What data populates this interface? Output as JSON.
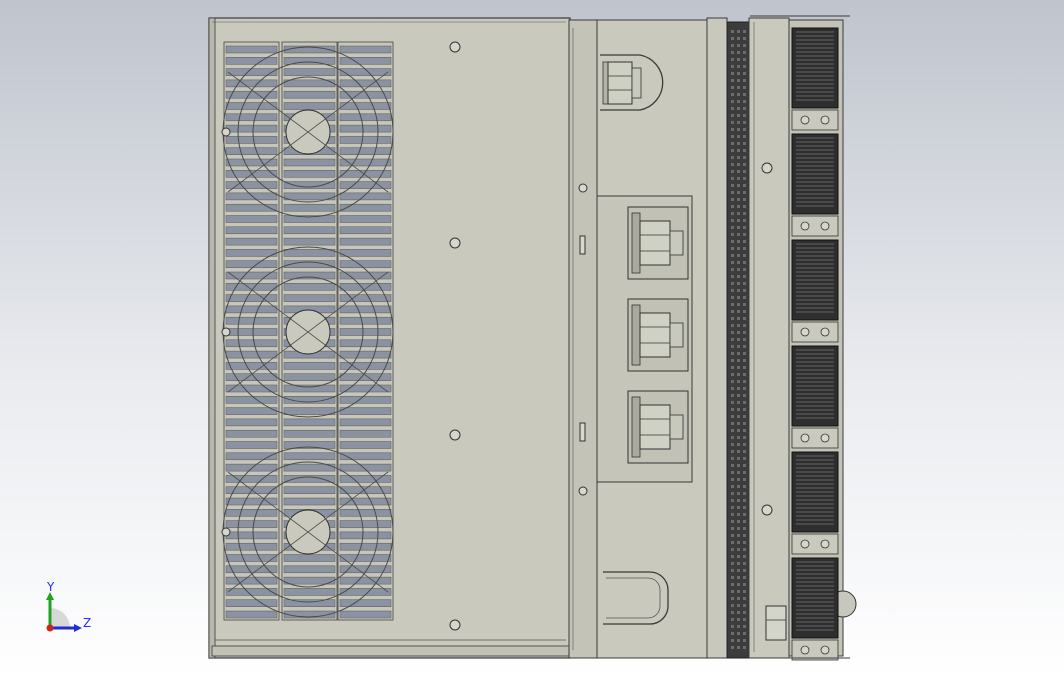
{
  "view": {
    "background_top": "#bfc4cd",
    "background_bottom": "#ffffff",
    "model_fill": "#c9cabd",
    "model_fill_dark": "#b8b9ac",
    "edge_color": "#3a3a3a",
    "grille_color": "#8b93a3"
  },
  "triad": {
    "y_label": "Y",
    "z_label": "Z",
    "y_color": "#1fa31f",
    "z_color": "#1f2fd8",
    "x_color": "#d21f1f"
  },
  "model": {
    "fan_rows": 3,
    "terminal_count": 3,
    "connector_count": 6
  }
}
